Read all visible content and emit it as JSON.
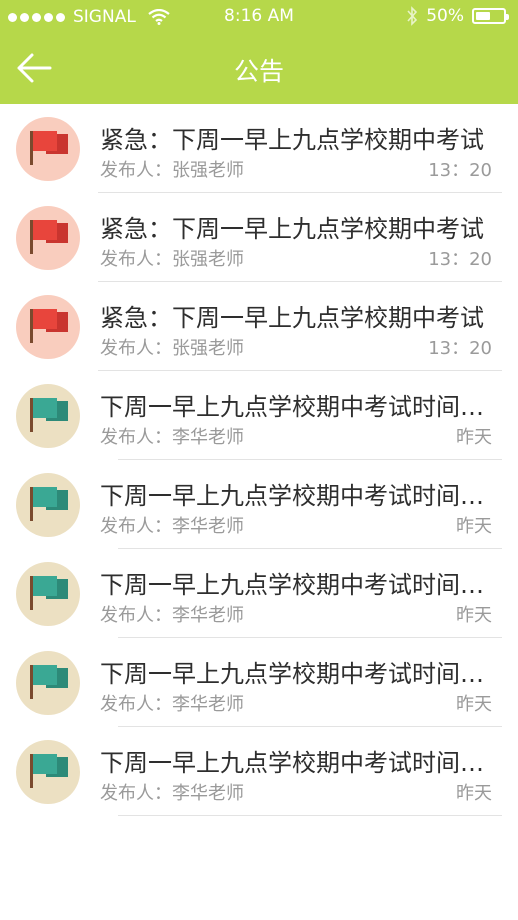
{
  "status_bar": {
    "carrier": "SIGNAL",
    "time": "8:16 AM",
    "battery": "50%",
    "battery_level": 0.5
  },
  "nav": {
    "title": "公告",
    "back_icon": "arrow-left-icon"
  },
  "announcements": [
    {
      "title": "紧急：下周一早上九点学校期中考试",
      "publisher": "发布人：张强老师",
      "time": "13：20",
      "type": "urgent",
      "icon": "red-flag-icon"
    },
    {
      "title": "紧急：下周一早上九点学校期中考试",
      "publisher": "发布人：张强老师",
      "time": "13：20",
      "type": "urgent",
      "icon": "red-flag-icon"
    },
    {
      "title": "紧急：下周一早上九点学校期中考试",
      "publisher": "发布人：张强老师",
      "time": "13：20",
      "type": "urgent",
      "icon": "red-flag-icon"
    },
    {
      "title": "下周一早上九点学校期中考试时间安排",
      "publisher": "发布人：李华老师",
      "time": "昨天",
      "type": "normal",
      "icon": "teal-flag-icon"
    },
    {
      "title": "下周一早上九点学校期中考试时间安排",
      "publisher": "发布人：李华老师",
      "time": "昨天",
      "type": "normal",
      "icon": "teal-flag-icon"
    },
    {
      "title": "下周一早上九点学校期中考试时间安排",
      "publisher": "发布人：李华老师",
      "time": "昨天",
      "type": "normal",
      "icon": "teal-flag-icon"
    },
    {
      "title": "下周一早上九点学校期中考试时间安排",
      "publisher": "发布人：李华老师",
      "time": "昨天",
      "type": "normal",
      "icon": "teal-flag-icon"
    },
    {
      "title": "下周一早上九点学校期中考试时间安排",
      "publisher": "发布人：李华老师",
      "time": "昨天",
      "type": "normal",
      "icon": "teal-flag-icon"
    }
  ],
  "colors": {
    "header": "#b6d84a",
    "urgent_circle": "#f9cdbe",
    "urgent_flag": "#e8453c",
    "normal_circle": "#ece0c2",
    "normal_flag": "#3aa894"
  }
}
